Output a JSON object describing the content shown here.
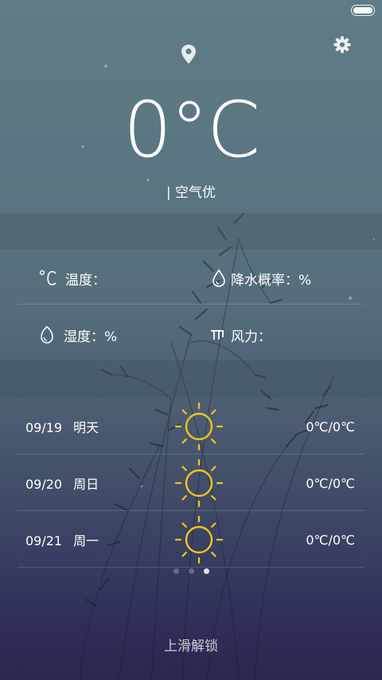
{
  "status": {
    "battery_level": 1.0
  },
  "header": {
    "temperature": "0°C",
    "air_quality": "| 空气优"
  },
  "details": {
    "temperature_label": "温度：",
    "precip_label": "降水概率：%",
    "humidity_label": "湿度：%",
    "wind_label": "风力："
  },
  "forecast": [
    {
      "date": "09/19",
      "day": "明天",
      "temp": "0℃/0℃",
      "icon": "sun-icon"
    },
    {
      "date": "09/20",
      "day": "周日",
      "temp": "0℃/0℃",
      "icon": "sun-icon"
    },
    {
      "date": "09/21",
      "day": "周一",
      "temp": "0℃/0℃",
      "icon": "sun-icon"
    }
  ],
  "pager": {
    "count": 3,
    "active": 3
  },
  "footer": {
    "unlock": "上滑解锁"
  },
  "colors": {
    "sun": "#f2c41c",
    "text": "#ffffff"
  }
}
